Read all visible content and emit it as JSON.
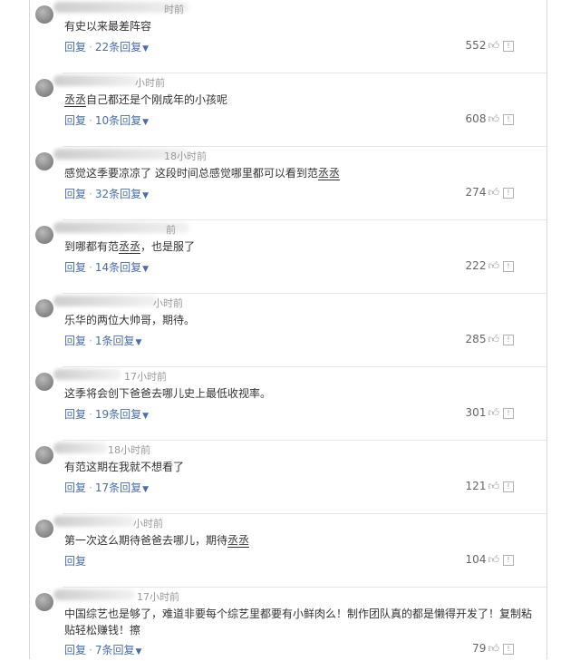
{
  "ui": {
    "reply_label": "回复",
    "reply_suffix": "条回复"
  },
  "comments": [
    {
      "time": "时前",
      "text": "有史以来最差阵容",
      "reply_count": "22",
      "likes": "552"
    },
    {
      "time": "小时前",
      "text_parts": [
        {
          "t": "丞丞",
          "hl": true
        },
        {
          "t": "自己都还是个刚成年的小孩呢"
        }
      ],
      "reply_count": "10",
      "likes": "608"
    },
    {
      "time": "18小时前",
      "text_parts": [
        {
          "t": "感觉这季要凉凉了 这段时间总感觉哪里都可以看到范"
        },
        {
          "t": "丞丞",
          "hl": true
        }
      ],
      "reply_count": "32",
      "likes": "274"
    },
    {
      "time": "前",
      "text_parts": [
        {
          "t": "到哪都有范"
        },
        {
          "t": "丞丞",
          "hl": true
        },
        {
          "t": "，也是服了"
        }
      ],
      "reply_count": "14",
      "likes": "222"
    },
    {
      "time": "小时前",
      "text": "乐华的两位大帅哥，期待。",
      "reply_count": "1",
      "likes": "285"
    },
    {
      "time": "17小时前",
      "text": "这季将会创下爸爸去哪儿史上最低收视率。",
      "reply_count": "19",
      "likes": "301"
    },
    {
      "time": "18小时前",
      "text": "有范这期在我就不想看了",
      "reply_count": "17",
      "likes": "121"
    },
    {
      "time": "小时前",
      "text_parts": [
        {
          "t": "第一次这么期待爸爸去哪儿，期待"
        },
        {
          "t": "丞丞",
          "hl": true
        }
      ],
      "reply_count": "",
      "likes": "104"
    },
    {
      "time": "17小时前",
      "text": "中国综艺也是够了，难道非要每个综艺里都要有小鲜肉么！制作团队真的都是懒得开发了！复制粘贴轻松赚钱！擦",
      "reply_count": "7",
      "likes": "79"
    }
  ]
}
